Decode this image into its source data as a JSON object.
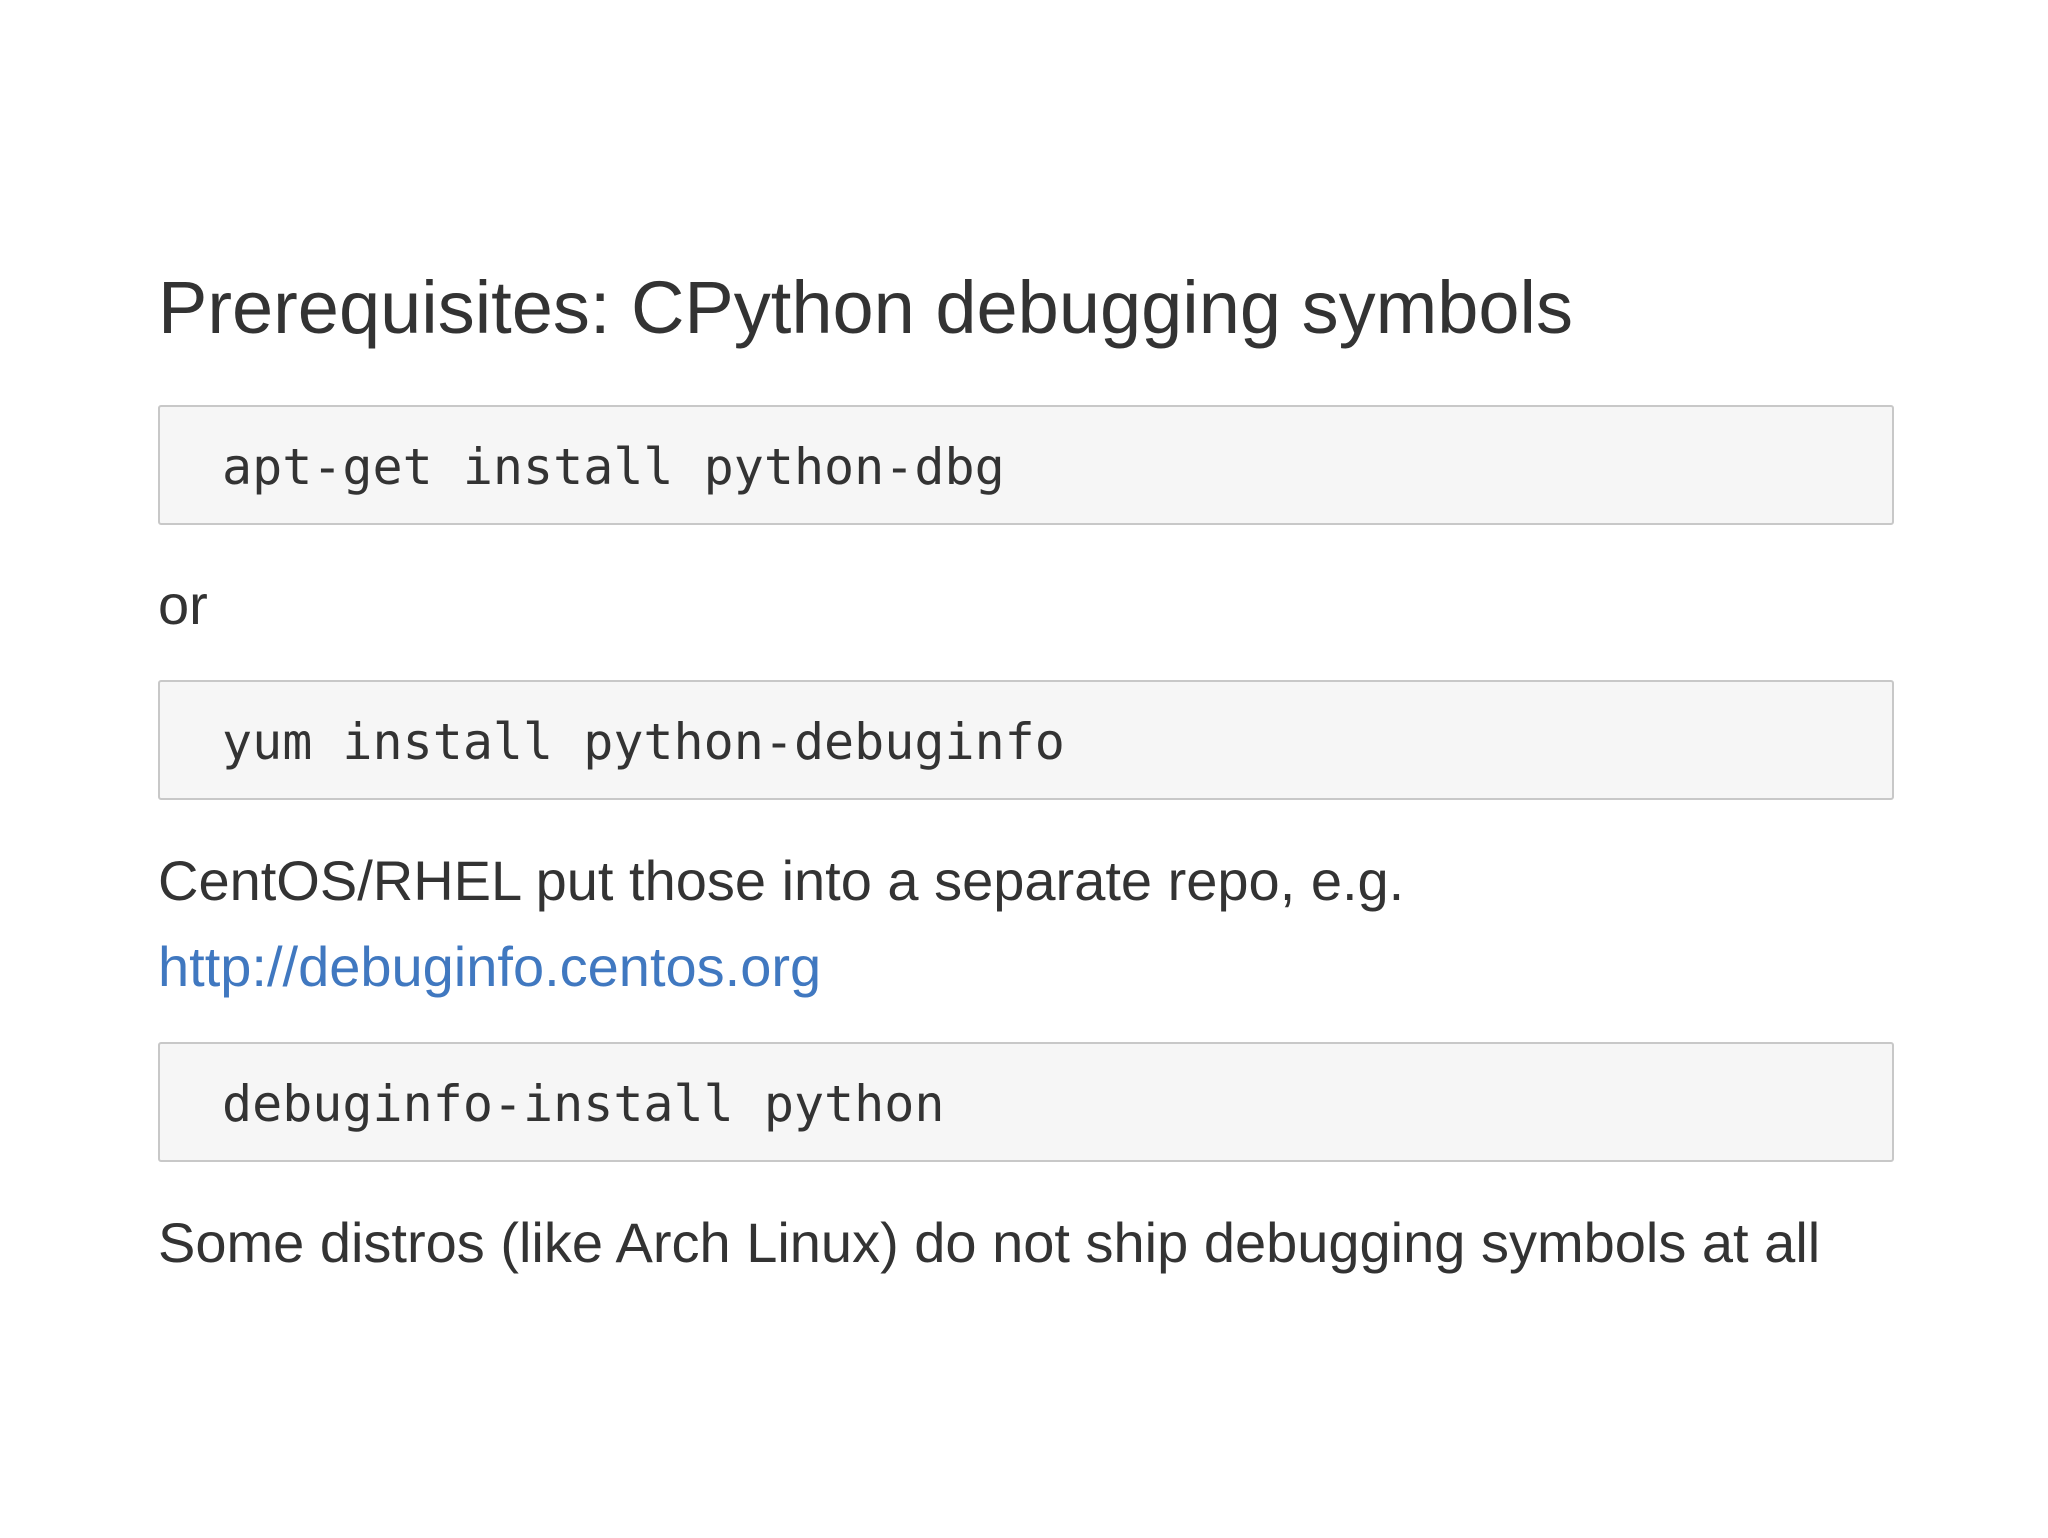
{
  "title": "Prerequisites: CPython debugging symbols",
  "commands": {
    "apt": "apt-get install python-dbg",
    "yum": "yum install python-debuginfo",
    "debuginfo": "debuginfo-install python"
  },
  "text": {
    "or": "or",
    "centos_note": "CentOS/RHEL put those into a separate repo, e.g.",
    "link": "http://debuginfo.centos.org",
    "arch_note": "Some distros (like Arch Linux) do not ship debugging symbols at all"
  },
  "colors": {
    "link": "#4078c0",
    "text": "#333333",
    "code_background": "#f6f6f6"
  }
}
